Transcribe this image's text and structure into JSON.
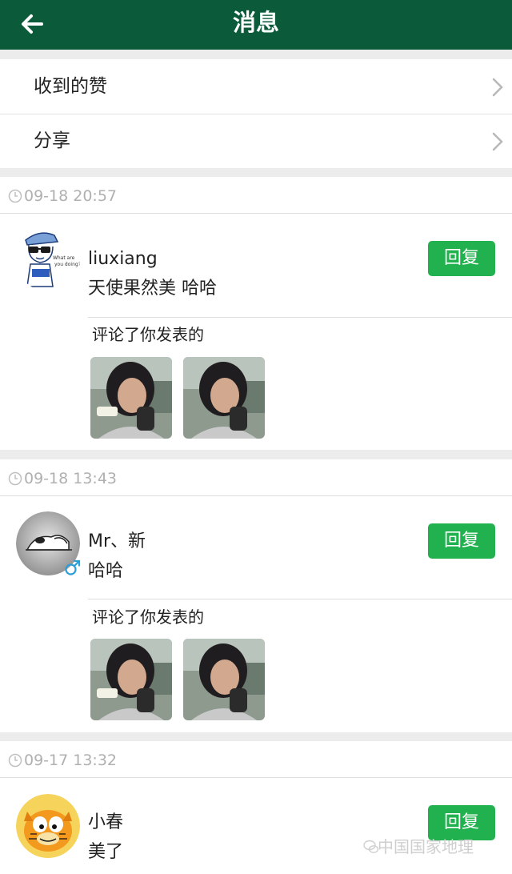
{
  "header": {
    "title": "消息"
  },
  "menu": {
    "items": [
      {
        "label": "收到的赞"
      },
      {
        "label": "分享"
      }
    ]
  },
  "notifications": [
    {
      "time": "09-18 20:57",
      "user": "liuxiang",
      "message": "天使果然美 哈哈",
      "reply_label": "回复",
      "ref_text": "评论了你发表的"
    },
    {
      "time": "09-18 13:43",
      "user": "Mr、新",
      "message": "哈哈",
      "reply_label": "回复",
      "ref_text": "评论了你发表的",
      "gender": "♂"
    },
    {
      "time": "09-17 13:32",
      "user": "小春",
      "message": "美了",
      "reply_label": "回复"
    }
  ],
  "watermark": {
    "text": "中国国家地理"
  },
  "colors": {
    "header": "#0b5b3b",
    "reply_button": "#21b14e",
    "gender": "#2a9fd8"
  },
  "icons": {
    "back": "arrow-left-icon",
    "chevron": "chevron-right-icon",
    "clock": "clock-icon"
  }
}
